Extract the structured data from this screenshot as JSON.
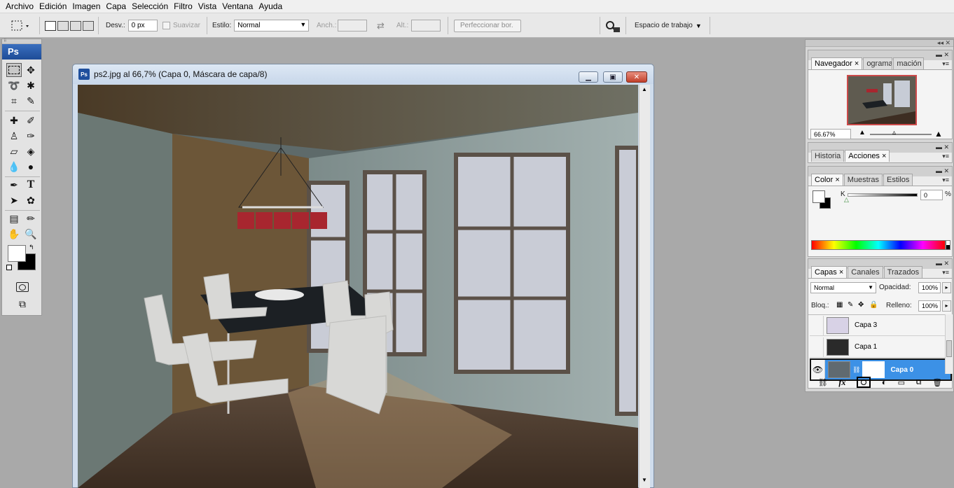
{
  "menu": [
    "Archivo",
    "Edición",
    "Imagen",
    "Capa",
    "Selección",
    "Filtro",
    "Vista",
    "Ventana",
    "Ayuda"
  ],
  "options": {
    "feather_label": "Desv.:",
    "feather_value": "0 px",
    "antialias_label": "Suavizar",
    "style_label": "Estilo:",
    "style_value": "Normal",
    "width_label": "Anch.:",
    "height_label": "Alt.:",
    "refine_label": "Perfeccionar bor.",
    "workspace_label": "Espacio de trabajo"
  },
  "toolbox": {
    "logo": "Ps"
  },
  "document": {
    "title": "ps2.jpg al 66,7% (Capa 0, Máscara de capa/8)",
    "icon_text": "Ps"
  },
  "navigator": {
    "tabs": [
      "Navegador",
      "ograma",
      "mación"
    ],
    "zoom": "66.67%"
  },
  "history": {
    "tabs": [
      "Historia",
      "Acciones"
    ]
  },
  "color": {
    "tabs": [
      "Color",
      "Muestras",
      "Estilos"
    ],
    "channel_label": "K",
    "channel_value": "0",
    "unit": "%"
  },
  "layers": {
    "tabs": [
      "Capas",
      "Canales",
      "Trazados"
    ],
    "blend_mode": "Normal",
    "opacity_label": "Opacidad:",
    "opacity_value": "100%",
    "lock_label": "Bloq.:",
    "fill_label": "Relleno:",
    "fill_value": "100%",
    "items": [
      {
        "name": "Capa 3",
        "visible": false
      },
      {
        "name": "Capa 1",
        "visible": false
      },
      {
        "name": "Capa 0",
        "visible": true,
        "selected": true
      }
    ],
    "footer_icons": [
      "link-icon",
      "fx-icon",
      "mask-icon",
      "adjustment-icon",
      "group-icon",
      "new-layer-icon",
      "trash-icon"
    ]
  },
  "colors": {
    "selected_layer": "#3c91e6",
    "ps_blue": "#1e4c97"
  }
}
